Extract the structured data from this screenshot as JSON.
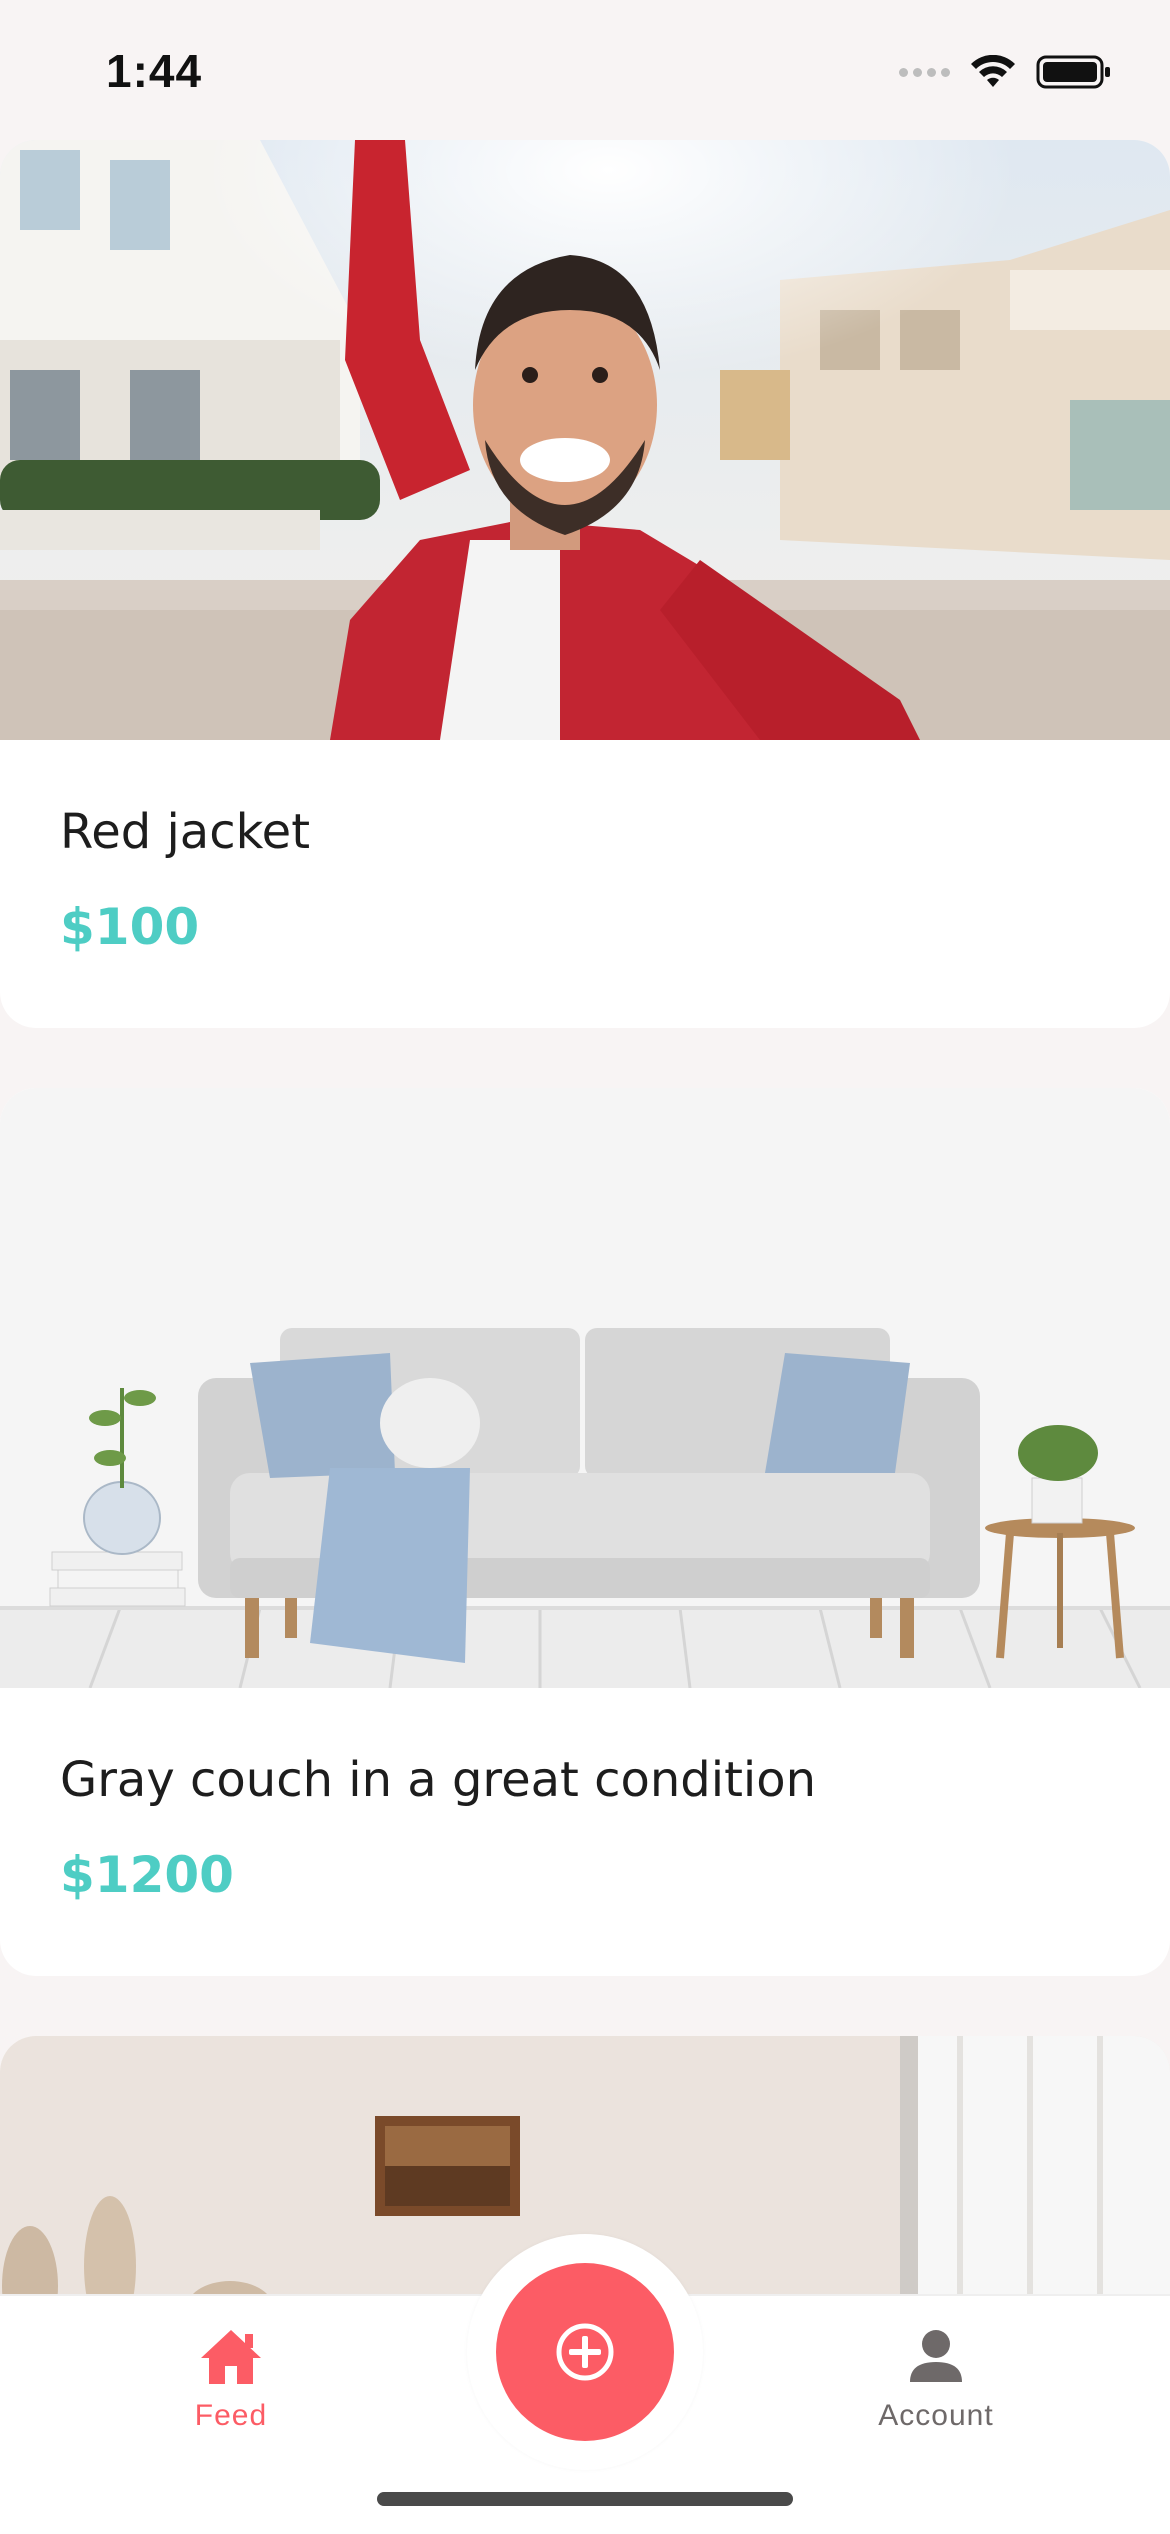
{
  "status_bar": {
    "time": "1:44"
  },
  "feed": {
    "listings": [
      {
        "title": "Red jacket",
        "price": "$100"
      },
      {
        "title": "Gray couch in a great condition",
        "price": "$1200"
      },
      {
        "title": "",
        "price": ""
      }
    ]
  },
  "tab_bar": {
    "feed_label": "Feed",
    "account_label": "Account"
  },
  "colors": {
    "primary": "#fc5c65",
    "secondary": "#4ecdc4",
    "medium": "#6e6969",
    "background": "#f8f4f4"
  },
  "icons": {
    "feed": "home-icon",
    "add": "plus-circle-icon",
    "account": "account-icon"
  }
}
